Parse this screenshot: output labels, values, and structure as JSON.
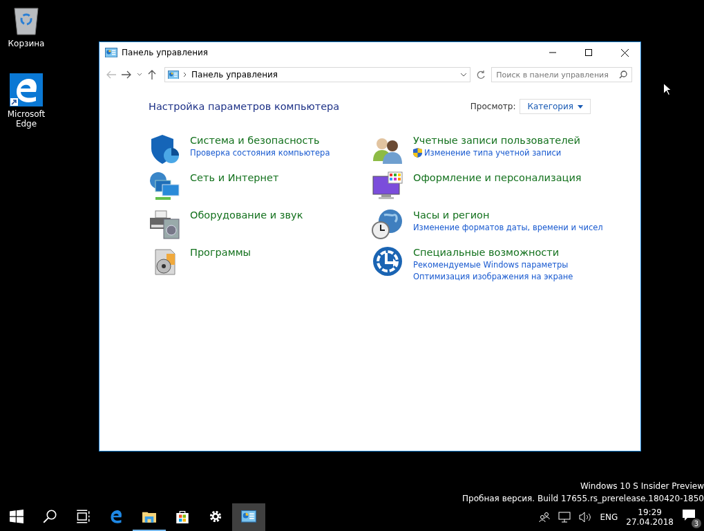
{
  "desktop_icons": [
    {
      "kind": "recycle-bin",
      "label": "Корзина"
    },
    {
      "kind": "edge",
      "label": "Microsoft Edge"
    }
  ],
  "window": {
    "title": "Панель управления",
    "address": "Панель управления",
    "search": {
      "placeholder": "Поиск в панели управления"
    },
    "heading": "Настройка параметров компьютера",
    "view_label": "Просмотр:",
    "view_value": "Категория",
    "categories": [
      {
        "kind": "shield",
        "title": "Система и безопасность",
        "links": [
          {
            "text": "Проверка состояния компьютера",
            "shield": false
          }
        ]
      },
      {
        "kind": "users",
        "title": "Учетные записи пользователей",
        "links": [
          {
            "text": "Изменение типа учетной записи",
            "shield": true
          }
        ]
      },
      {
        "kind": "network",
        "title": "Сеть и Интернет"
      },
      {
        "kind": "display",
        "title": "Оформление и персонализация"
      },
      {
        "kind": "printer",
        "title": "Оборудование и звук"
      },
      {
        "kind": "clock",
        "title": "Часы и регион",
        "links": [
          {
            "text": "Изменение форматов даты, времени и чисел",
            "shield": false
          }
        ]
      },
      {
        "kind": "programs",
        "title": "Программы"
      },
      {
        "kind": "access",
        "title": "Специальные возможности",
        "links": [
          {
            "text": "Рекомендуемые Windows параметры",
            "shield": false
          },
          {
            "text": "Оптимизация изображения на экране",
            "shield": false
          }
        ]
      }
    ]
  },
  "build_info": [
    "Windows 10 S Insider Preview",
    "Пробная версия. Build 17655.rs_prerelease.180420-1850"
  ],
  "taskbar": {
    "items": [
      {
        "kind": "start",
        "running": false,
        "selected": false
      },
      {
        "kind": "search",
        "running": false,
        "selected": false
      },
      {
        "kind": "task-view",
        "running": false,
        "selected": false
      },
      {
        "kind": "edge",
        "running": false,
        "selected": false
      },
      {
        "kind": "explorer",
        "running": true,
        "selected": false
      },
      {
        "kind": "store",
        "running": false,
        "selected": false
      },
      {
        "kind": "settings",
        "running": false,
        "selected": false
      },
      {
        "kind": "control-panel",
        "running": false,
        "selected": true
      }
    ],
    "language": "ENG",
    "time": "19:29",
    "date": "27.04.2018",
    "notifications": "3"
  }
}
